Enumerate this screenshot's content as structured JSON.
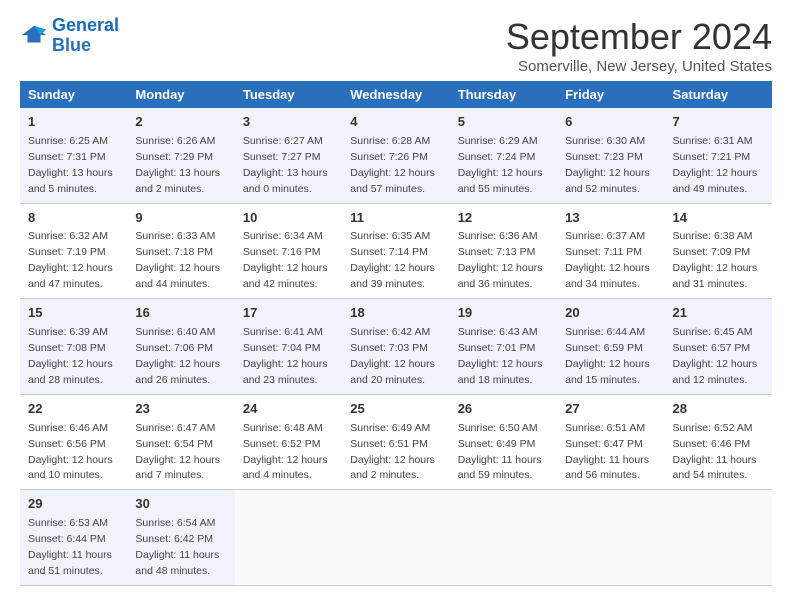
{
  "header": {
    "logo_line1": "General",
    "logo_line2": "Blue",
    "month": "September 2024",
    "location": "Somerville, New Jersey, United States"
  },
  "days_of_week": [
    "Sunday",
    "Monday",
    "Tuesday",
    "Wednesday",
    "Thursday",
    "Friday",
    "Saturday"
  ],
  "weeks": [
    [
      {
        "day": "1",
        "sunrise": "6:25 AM",
        "sunset": "7:31 PM",
        "daylight": "13 hours and 5 minutes."
      },
      {
        "day": "2",
        "sunrise": "6:26 AM",
        "sunset": "7:29 PM",
        "daylight": "13 hours and 2 minutes."
      },
      {
        "day": "3",
        "sunrise": "6:27 AM",
        "sunset": "7:27 PM",
        "daylight": "13 hours and 0 minutes."
      },
      {
        "day": "4",
        "sunrise": "6:28 AM",
        "sunset": "7:26 PM",
        "daylight": "12 hours and 57 minutes."
      },
      {
        "day": "5",
        "sunrise": "6:29 AM",
        "sunset": "7:24 PM",
        "daylight": "12 hours and 55 minutes."
      },
      {
        "day": "6",
        "sunrise": "6:30 AM",
        "sunset": "7:23 PM",
        "daylight": "12 hours and 52 minutes."
      },
      {
        "day": "7",
        "sunrise": "6:31 AM",
        "sunset": "7:21 PM",
        "daylight": "12 hours and 49 minutes."
      }
    ],
    [
      {
        "day": "8",
        "sunrise": "6:32 AM",
        "sunset": "7:19 PM",
        "daylight": "12 hours and 47 minutes."
      },
      {
        "day": "9",
        "sunrise": "6:33 AM",
        "sunset": "7:18 PM",
        "daylight": "12 hours and 44 minutes."
      },
      {
        "day": "10",
        "sunrise": "6:34 AM",
        "sunset": "7:16 PM",
        "daylight": "12 hours and 42 minutes."
      },
      {
        "day": "11",
        "sunrise": "6:35 AM",
        "sunset": "7:14 PM",
        "daylight": "12 hours and 39 minutes."
      },
      {
        "day": "12",
        "sunrise": "6:36 AM",
        "sunset": "7:13 PM",
        "daylight": "12 hours and 36 minutes."
      },
      {
        "day": "13",
        "sunrise": "6:37 AM",
        "sunset": "7:11 PM",
        "daylight": "12 hours and 34 minutes."
      },
      {
        "day": "14",
        "sunrise": "6:38 AM",
        "sunset": "7:09 PM",
        "daylight": "12 hours and 31 minutes."
      }
    ],
    [
      {
        "day": "15",
        "sunrise": "6:39 AM",
        "sunset": "7:08 PM",
        "daylight": "12 hours and 28 minutes."
      },
      {
        "day": "16",
        "sunrise": "6:40 AM",
        "sunset": "7:06 PM",
        "daylight": "12 hours and 26 minutes."
      },
      {
        "day": "17",
        "sunrise": "6:41 AM",
        "sunset": "7:04 PM",
        "daylight": "12 hours and 23 minutes."
      },
      {
        "day": "18",
        "sunrise": "6:42 AM",
        "sunset": "7:03 PM",
        "daylight": "12 hours and 20 minutes."
      },
      {
        "day": "19",
        "sunrise": "6:43 AM",
        "sunset": "7:01 PM",
        "daylight": "12 hours and 18 minutes."
      },
      {
        "day": "20",
        "sunrise": "6:44 AM",
        "sunset": "6:59 PM",
        "daylight": "12 hours and 15 minutes."
      },
      {
        "day": "21",
        "sunrise": "6:45 AM",
        "sunset": "6:57 PM",
        "daylight": "12 hours and 12 minutes."
      }
    ],
    [
      {
        "day": "22",
        "sunrise": "6:46 AM",
        "sunset": "6:56 PM",
        "daylight": "12 hours and 10 minutes."
      },
      {
        "day": "23",
        "sunrise": "6:47 AM",
        "sunset": "6:54 PM",
        "daylight": "12 hours and 7 minutes."
      },
      {
        "day": "24",
        "sunrise": "6:48 AM",
        "sunset": "6:52 PM",
        "daylight": "12 hours and 4 minutes."
      },
      {
        "day": "25",
        "sunrise": "6:49 AM",
        "sunset": "6:51 PM",
        "daylight": "12 hours and 2 minutes."
      },
      {
        "day": "26",
        "sunrise": "6:50 AM",
        "sunset": "6:49 PM",
        "daylight": "11 hours and 59 minutes."
      },
      {
        "day": "27",
        "sunrise": "6:51 AM",
        "sunset": "6:47 PM",
        "daylight": "11 hours and 56 minutes."
      },
      {
        "day": "28",
        "sunrise": "6:52 AM",
        "sunset": "6:46 PM",
        "daylight": "11 hours and 54 minutes."
      }
    ],
    [
      {
        "day": "29",
        "sunrise": "6:53 AM",
        "sunset": "6:44 PM",
        "daylight": "11 hours and 51 minutes."
      },
      {
        "day": "30",
        "sunrise": "6:54 AM",
        "sunset": "6:42 PM",
        "daylight": "11 hours and 48 minutes."
      },
      null,
      null,
      null,
      null,
      null
    ]
  ]
}
